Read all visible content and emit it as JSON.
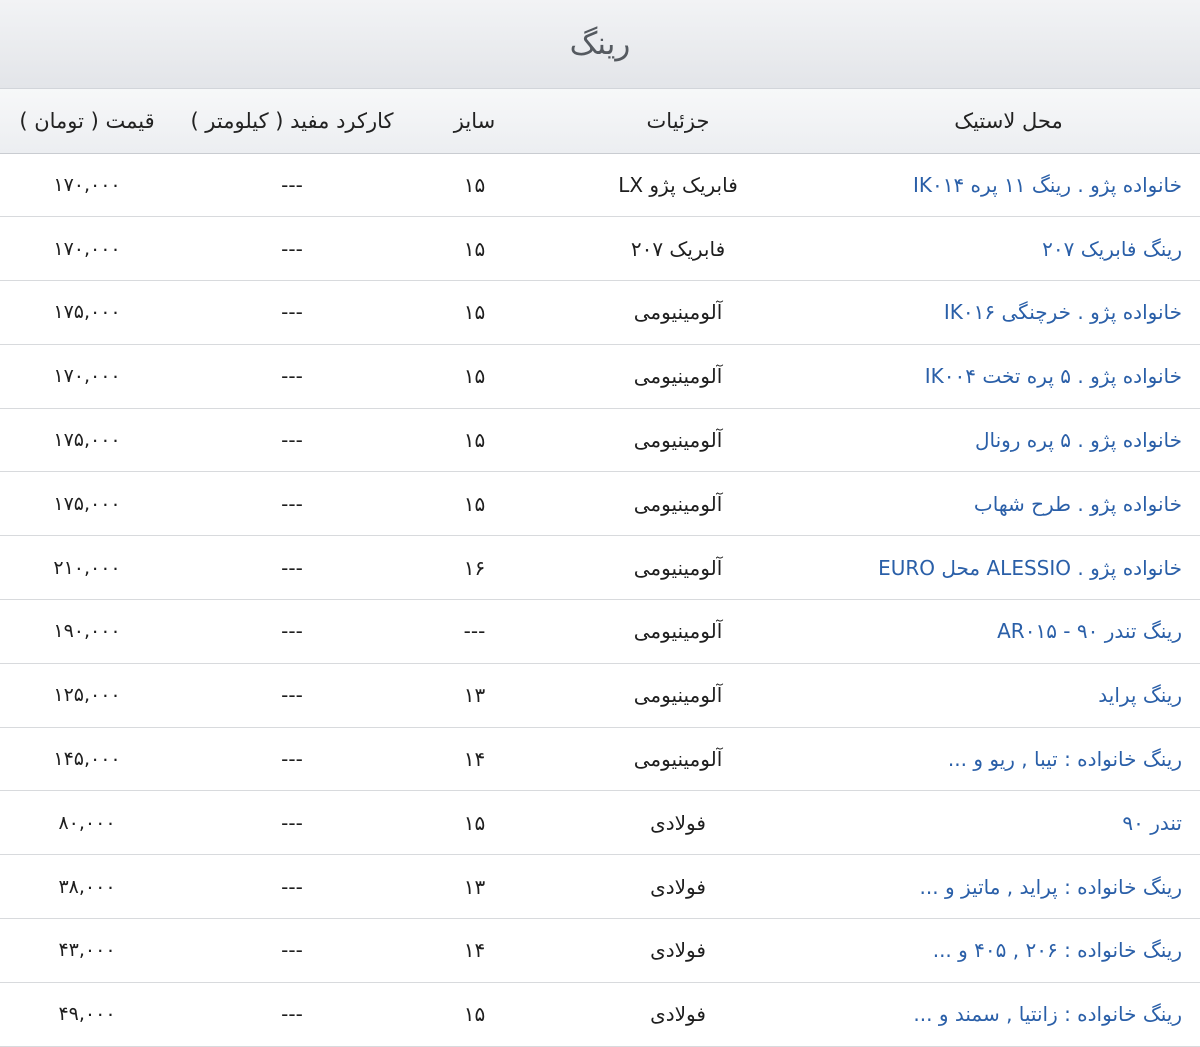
{
  "title": "رینگ",
  "columns": {
    "product": "محل لاستیک",
    "details": "جزئیات",
    "size": "سایز",
    "mileage": "کارکرد مفید ( کیلومتر )",
    "price": "قیمت ( تومان )"
  },
  "rows": [
    {
      "product": "خانواده پژو . رینگ ۱۱ پره IK۰۱۴",
      "details": "فابریک پژو LX",
      "size": "۱۵",
      "mileage": "---",
      "price": "۱۷۰,۰۰۰"
    },
    {
      "product": "رینگ فابریک ۲۰۷",
      "details": "فابریک ۲۰۷",
      "size": "۱۵",
      "mileage": "---",
      "price": "۱۷۰,۰۰۰"
    },
    {
      "product": "خانواده پژو . خرچنگی IK۰۱۶",
      "details": "آلومینیومی",
      "size": "۱۵",
      "mileage": "---",
      "price": "۱۷۵,۰۰۰"
    },
    {
      "product": "خانواده پژو . ۵ پره تخت IK۰۰۴",
      "details": "آلومینیومی",
      "size": "۱۵",
      "mileage": "---",
      "price": "۱۷۰,۰۰۰"
    },
    {
      "product": "خانواده پژو . ۵ پره رونال",
      "details": "آلومینیومی",
      "size": "۱۵",
      "mileage": "---",
      "price": "۱۷۵,۰۰۰"
    },
    {
      "product": "خانواده پژو . طرح شهاب",
      "details": "آلومینیومی",
      "size": "۱۵",
      "mileage": "---",
      "price": "۱۷۵,۰۰۰"
    },
    {
      "product": "خانواده پژو . ALESSIO محل EURO",
      "details": "آلومینیومی",
      "size": "۱۶",
      "mileage": "---",
      "price": "۲۱۰,۰۰۰"
    },
    {
      "product": "رینگ تندر ۹۰ - AR۰۱۵",
      "details": "آلومینیومی",
      "size": "---",
      "mileage": "---",
      "price": "۱۹۰,۰۰۰"
    },
    {
      "product": "رینگ پراید",
      "details": "آلومینیومی",
      "size": "۱۳",
      "mileage": "---",
      "price": "۱۲۵,۰۰۰"
    },
    {
      "product": "رینگ خانواده : تیبا , ریو و ...",
      "details": "آلومینیومی",
      "size": "۱۴",
      "mileage": "---",
      "price": "۱۴۵,۰۰۰"
    },
    {
      "product": "تندر ۹۰",
      "details": "فولادی",
      "size": "۱۵",
      "mileage": "---",
      "price": "۸۰,۰۰۰"
    },
    {
      "product": "رینگ خانواده : پراید , ماتیز و ...",
      "details": "فولادی",
      "size": "۱۳",
      "mileage": "---",
      "price": "۳۸,۰۰۰"
    },
    {
      "product": "رینگ خانواده : ۲۰۶ , ۴۰۵ و ...",
      "details": "فولادی",
      "size": "۱۴",
      "mileage": "---",
      "price": "۴۳,۰۰۰"
    },
    {
      "product": "رینگ خانواده : زانتیا , سمند و ...",
      "details": "فولادی",
      "size": "۱۵",
      "mileage": "---",
      "price": "۴۹,۰۰۰"
    }
  ],
  "colors": {
    "link": "#2a5fa8",
    "title_text": "#555a60",
    "row_border": "#d8dadd"
  }
}
